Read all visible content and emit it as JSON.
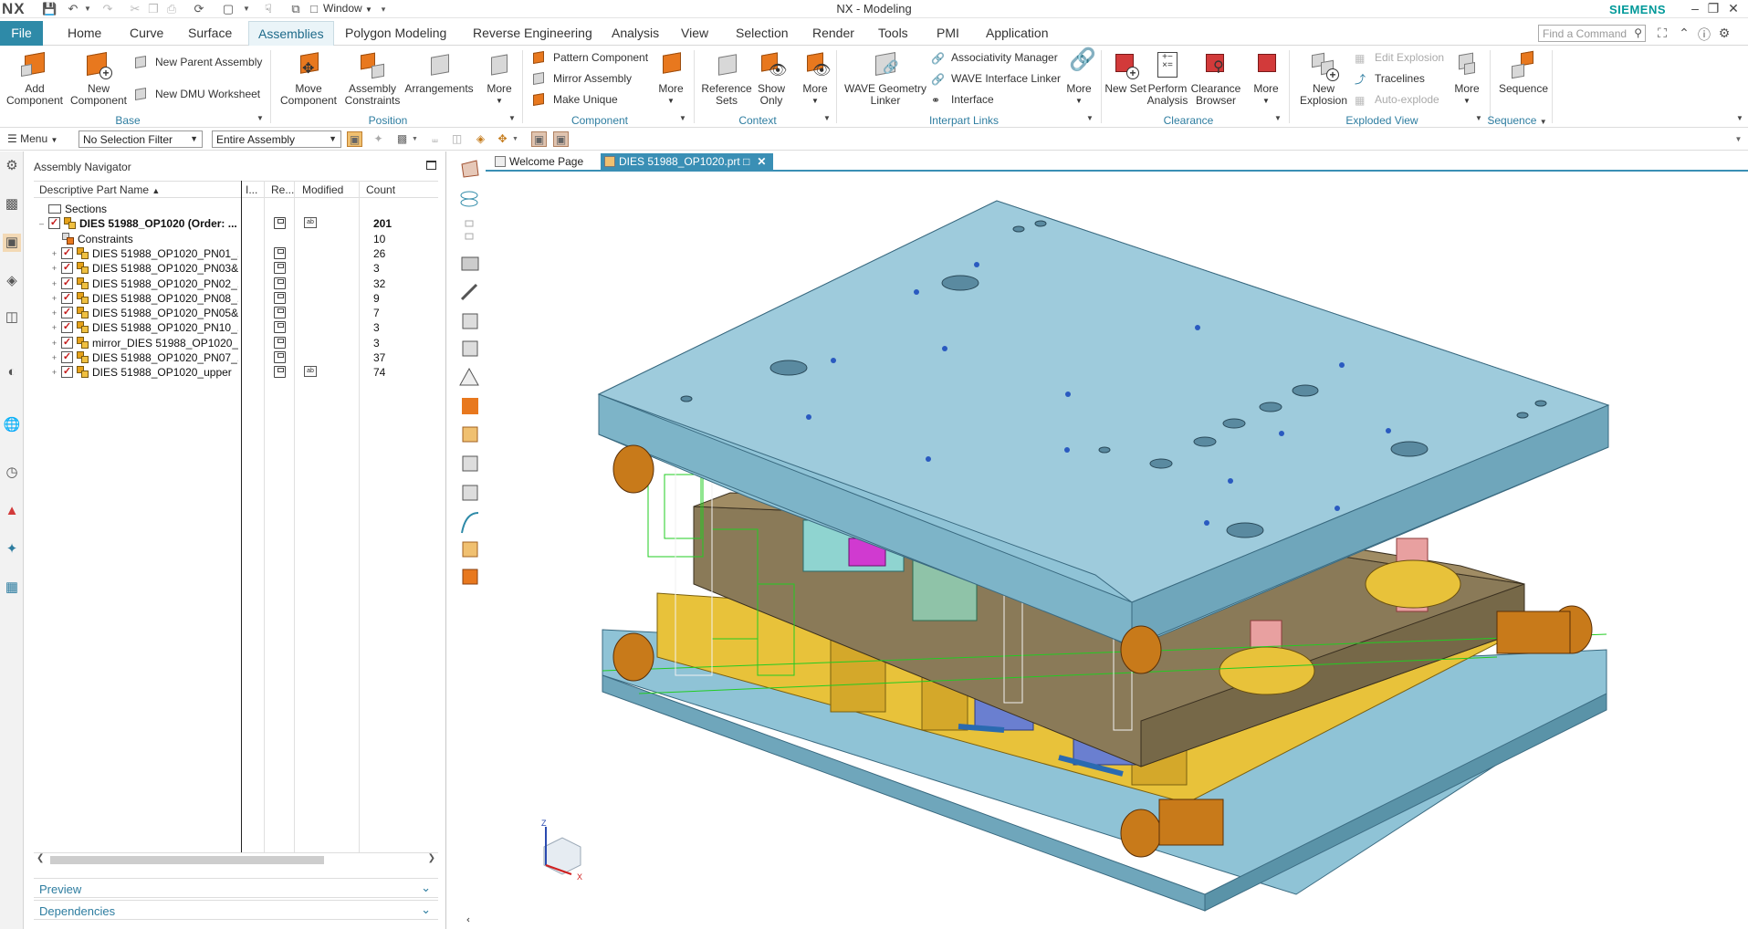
{
  "app": {
    "logo": "NX",
    "title": "NX - Modeling",
    "brand": "SIEMENS",
    "window_menu": "Window"
  },
  "tabs": {
    "file": "File",
    "items": [
      "Home",
      "Curve",
      "Surface",
      "Assemblies",
      "Polygon Modeling",
      "Reverse Engineering",
      "Analysis",
      "View",
      "Selection",
      "Render",
      "Tools",
      "PMI",
      "Application"
    ],
    "active": "Assemblies"
  },
  "command_search": {
    "placeholder": "Find a Command"
  },
  "ribbon": {
    "base": {
      "label": "Base",
      "add_component": "Add Component",
      "new_component": "New Component",
      "new_parent_assembly": "New Parent Assembly",
      "new_dmu_worksheet": "New DMU Worksheet"
    },
    "position": {
      "label": "Position",
      "move_component": "Move Component",
      "assembly_constraints": "Assembly Constraints",
      "arrangements": "Arrangements",
      "more": "More"
    },
    "component": {
      "label": "Component",
      "pattern_component": "Pattern Component",
      "mirror_assembly": "Mirror Assembly",
      "make_unique": "Make Unique",
      "more": "More"
    },
    "context": {
      "label": "Context",
      "reference_sets": "Reference Sets",
      "show_only": "Show Only",
      "more": "More"
    },
    "interpart_links": {
      "label": "Interpart Links",
      "wave_geometry_linker": "WAVE Geometry Linker",
      "associativity_manager": "Associativity Manager",
      "wave_interface_linker": "WAVE Interface Linker",
      "interface": "Interface",
      "more": "More"
    },
    "clearance": {
      "label": "Clearance",
      "new_set": "New Set",
      "perform_analysis": "Perform Analysis",
      "clearance_browser": "Clearance Browser",
      "more": "More"
    },
    "exploded_view": {
      "label": "Exploded View",
      "new_explosion": "New Explosion",
      "edit_explosion": "Edit Explosion",
      "tracelines": "Tracelines",
      "auto_explode": "Auto-explode",
      "more": "More"
    },
    "sequence": {
      "label": "Sequence",
      "sequence": "Sequence"
    }
  },
  "selection_bar": {
    "menu": "Menu",
    "filter": "No Selection Filter",
    "scope": "Entire Assembly"
  },
  "navigator": {
    "title": "Assembly Navigator",
    "columns": [
      "Descriptive Part Name",
      "I...",
      "Re...",
      "Modified",
      "Count"
    ],
    "rows": [
      {
        "name": "Sections",
        "count": "",
        "kind": "folder",
        "level": 0,
        "bold": false
      },
      {
        "name": "DIES 51988_OP1020 (Order: ...",
        "count": "201",
        "kind": "root",
        "level": 0,
        "bold": true
      },
      {
        "name": "Constraints",
        "count": "10",
        "kind": "constraints",
        "level": 1,
        "bold": false
      },
      {
        "name": "DIES 51988_OP1020_PN01_...",
        "count": "26",
        "kind": "asm",
        "level": 1,
        "bold": false
      },
      {
        "name": "DIES 51988_OP1020_PN03&...",
        "count": "3",
        "kind": "asm",
        "level": 1,
        "bold": false
      },
      {
        "name": "DIES 51988_OP1020_PN02_...",
        "count": "32",
        "kind": "asm",
        "level": 1,
        "bold": false
      },
      {
        "name": "DIES 51988_OP1020_PN08_...",
        "count": "9",
        "kind": "asm",
        "level": 1,
        "bold": false
      },
      {
        "name": "DIES 51988_OP1020_PN05&...",
        "count": "7",
        "kind": "asm",
        "level": 1,
        "bold": false
      },
      {
        "name": "DIES 51988_OP1020_PN10_...",
        "count": "3",
        "kind": "asm",
        "level": 1,
        "bold": false
      },
      {
        "name": "mirror_DIES 51988_OP1020_...",
        "count": "3",
        "kind": "asm",
        "level": 1,
        "bold": false
      },
      {
        "name": "DIES 51988_OP1020_PN07_...",
        "count": "37",
        "kind": "asm",
        "level": 1,
        "bold": false
      },
      {
        "name": "DIES 51988_OP1020_upper",
        "count": "74",
        "kind": "asm",
        "level": 1,
        "bold": false
      }
    ],
    "preview": "Preview",
    "dependencies": "Dependencies"
  },
  "graphics_tabs": {
    "welcome": "Welcome Page",
    "part": "DIES 51988_OP1020.prt"
  },
  "triad": {
    "z": "Z",
    "x": "X"
  },
  "colors": {
    "accent": "#2e8aa8",
    "plate": "#8fc3d6",
    "brown_plate": "#8a7a58",
    "yellow": "#e8c23a",
    "orange": "#c87a1a",
    "green_wire": "#22cc22"
  }
}
